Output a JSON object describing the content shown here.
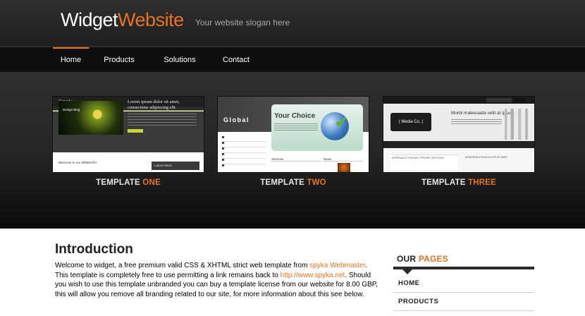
{
  "brand": {
    "name_part1": "Widget",
    "name_part2": "Website",
    "slogan": "Your website slogan here",
    "accent_color": "#e8731e"
  },
  "nav": {
    "items": [
      "Home",
      "Products",
      "Solutions",
      "Contact"
    ],
    "active": "Home"
  },
  "templates": [
    {
      "caption_prefix": "TEMPLATE",
      "caption_highlight": "ONE",
      "thumb": {
        "title": "Simple",
        "image_label": "Design Blog",
        "heading": "Lorem ipsum dolor sit amet, consectetur adipiscing elit.",
        "welcome": "Welcome to our WEBSITE!",
        "sidebar": "Latest News"
      }
    },
    {
      "caption_prefix": "TEMPLATE",
      "caption_highlight": "TWO",
      "thumb": {
        "title": "Global",
        "heading": "Your Choice",
        "section1": "Services",
        "section2": "News"
      }
    },
    {
      "caption_prefix": "TEMPLATE",
      "caption_highlight": "THREE",
      "thumb": {
        "logo": "( Media Co. )",
        "heading": "Morbi malesuada velit at ipsum",
        "box_text": "SPERDAM AT SEM NEC PRIOSIS TRISTIQUE",
        "side_text": "NEMORUM IPSUM DOLOR SIT AMET"
      }
    }
  ],
  "intro": {
    "title": "Introduction",
    "text_before_link1": "Welcome to widget, a free premium valid CSS & XHTML strict web template from ",
    "link1": "spyka Webmaster",
    "text_between": ". This template is completely free to use permitting a link remains back to ",
    "link2": "http://www.spyka.net",
    "text_after": ". Should you wish to use this template unbranded you can buy a template license from our website for 8.00 GBP, this will allow you remove all branding related to our site, for more information about this see below."
  },
  "our_pages": {
    "title_part1": "OUR",
    "title_part2": "PAGES",
    "items": [
      "HOME",
      "PRODUCTS"
    ]
  }
}
